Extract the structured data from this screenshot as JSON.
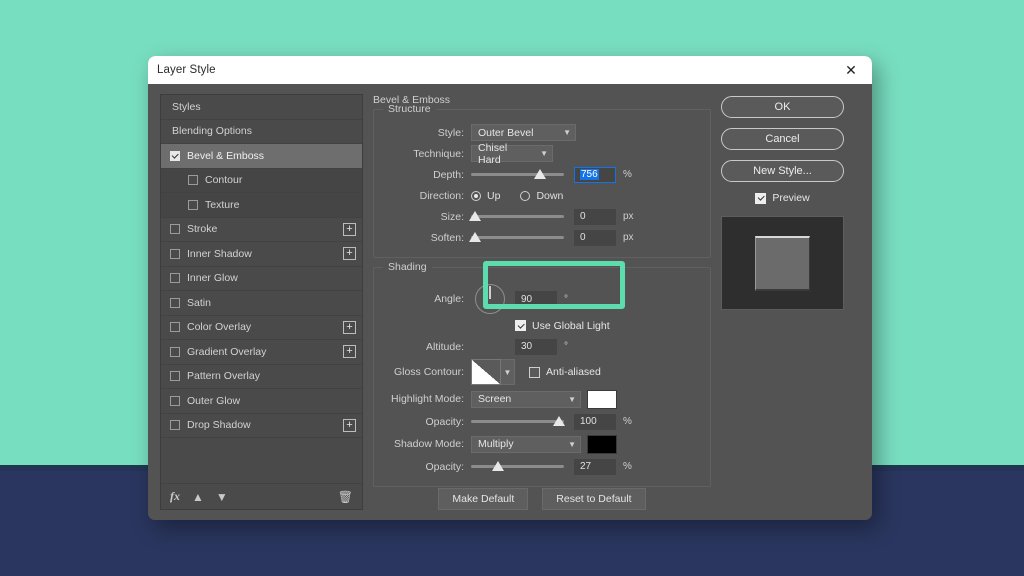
{
  "window": {
    "title": "Layer Style",
    "close_icon": "close-icon"
  },
  "sidebar": {
    "items": [
      {
        "label": "Styles",
        "type": "plain",
        "checkbox": null,
        "plus": false
      },
      {
        "label": "Blending Options",
        "type": "plain",
        "checkbox": null,
        "plus": false
      },
      {
        "label": "Bevel & Emboss",
        "type": "selected",
        "checkbox": true,
        "plus": false
      },
      {
        "label": "Contour",
        "type": "sub",
        "checkbox": false,
        "plus": false
      },
      {
        "label": "Texture",
        "type": "sub",
        "checkbox": false,
        "plus": false
      },
      {
        "label": "Stroke",
        "type": "normal",
        "checkbox": false,
        "plus": true
      },
      {
        "label": "Inner Shadow",
        "type": "normal",
        "checkbox": false,
        "plus": true
      },
      {
        "label": "Inner Glow",
        "type": "normal",
        "checkbox": false,
        "plus": false
      },
      {
        "label": "Satin",
        "type": "normal",
        "checkbox": false,
        "plus": false
      },
      {
        "label": "Color Overlay",
        "type": "normal",
        "checkbox": false,
        "plus": true
      },
      {
        "label": "Gradient Overlay",
        "type": "normal",
        "checkbox": false,
        "plus": true
      },
      {
        "label": "Pattern Overlay",
        "type": "normal",
        "checkbox": false,
        "plus": false
      },
      {
        "label": "Outer Glow",
        "type": "normal",
        "checkbox": false,
        "plus": false
      },
      {
        "label": "Drop Shadow",
        "type": "normal",
        "checkbox": false,
        "plus": true
      }
    ],
    "footer": {
      "fx_label": "fx",
      "up_arrow": "▲",
      "down_arrow": "▼",
      "trash": "🗑"
    }
  },
  "main": {
    "effect_title": "Bevel & Emboss",
    "structure": {
      "legend": "Structure",
      "style_label": "Style:",
      "style_value": "Outer Bevel",
      "technique_label": "Technique:",
      "technique_value": "Chisel Hard",
      "depth_label": "Depth:",
      "depth_value": "756",
      "depth_unit": "%",
      "direction_label": "Direction:",
      "direction_up": "Up",
      "direction_down": "Down",
      "size_label": "Size:",
      "size_value": "0",
      "size_unit": "px",
      "soften_label": "Soften:",
      "soften_value": "0",
      "soften_unit": "px"
    },
    "shading": {
      "legend": "Shading",
      "angle_label": "Angle:",
      "angle_value": "90",
      "angle_unit": "°",
      "use_global_light": "Use Global Light",
      "altitude_label": "Altitude:",
      "altitude_value": "30",
      "altitude_unit": "°",
      "gloss_label": "Gloss Contour:",
      "anti_aliased": "Anti-aliased",
      "highlight_mode_label": "Highlight Mode:",
      "highlight_mode_value": "Screen",
      "highlight_color": "#ffffff",
      "highlight_opacity_label": "Opacity:",
      "highlight_opacity_value": "100",
      "highlight_opacity_unit": "%",
      "shadow_mode_label": "Shadow Mode:",
      "shadow_mode_value": "Multiply",
      "shadow_color": "#000000",
      "shadow_opacity_label": "Opacity:",
      "shadow_opacity_value": "27",
      "shadow_opacity_unit": "%"
    },
    "buttons": {
      "make_default": "Make Default",
      "reset_to_default": "Reset to Default"
    },
    "highlight_color": "#5ddcae"
  },
  "right": {
    "ok": "OK",
    "cancel": "Cancel",
    "new_style": "New Style...",
    "preview": "Preview"
  }
}
